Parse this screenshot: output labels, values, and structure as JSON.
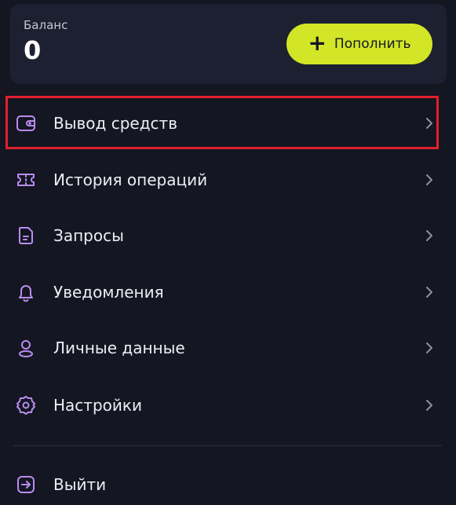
{
  "balance": {
    "label": "Баланс",
    "value": "0"
  },
  "topup": {
    "icon": "plus-icon",
    "label": "Пополнить",
    "color": "#d2e627"
  },
  "menu": {
    "items": [
      {
        "label": "Вывод средств",
        "icon": "wallet-icon",
        "highlighted": true
      },
      {
        "label": "История операций",
        "icon": "ticket-icon"
      },
      {
        "label": "Запросы",
        "icon": "document-icon"
      },
      {
        "label": "Уведомления",
        "icon": "bell-icon"
      },
      {
        "label": "Личные данные",
        "icon": "user-icon"
      },
      {
        "label": "Настройки",
        "icon": "gear-icon"
      }
    ],
    "logout": {
      "label": "Выйти",
      "icon": "logout-icon"
    }
  },
  "colors": {
    "background": "#141622",
    "card": "#1d2030",
    "accent_icon": "#b98cf0",
    "highlight_border": "#e0202c"
  }
}
